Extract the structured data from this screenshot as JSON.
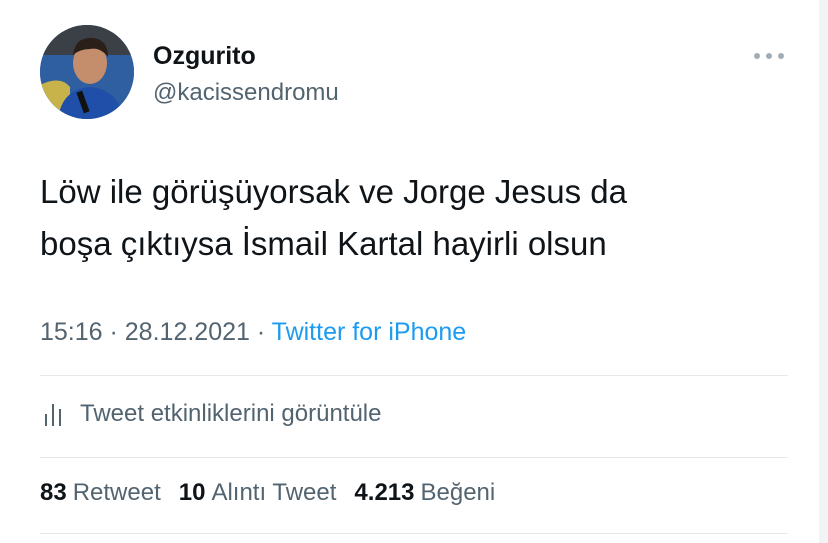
{
  "author": {
    "display_name": "Ozgurito",
    "handle": "@kacissendromu"
  },
  "tweet": {
    "line1": "Löw ile görüşüyorsak ve Jorge Jesus da",
    "line2": "boşa çıktıysa İsmail Kartal hayirli olsun"
  },
  "meta": {
    "time": "15:16",
    "separator1": " · ",
    "date": "28.12.2021",
    "separator2": " · ",
    "source": "Twitter for iPhone"
  },
  "activity": {
    "icon": "bar-chart-icon",
    "label": "Tweet etkinliklerini görüntüle"
  },
  "stats": {
    "retweets_count": "83",
    "retweets_label": "Retweet",
    "quotes_count": "10",
    "quotes_label": "Alıntı Tweet",
    "likes_count": "4.213",
    "likes_label": "Beğeni"
  },
  "colors": {
    "accent": "#1d9bf0",
    "text": "#0f1419",
    "secondary": "#536471",
    "divider": "#e5e9ec"
  }
}
